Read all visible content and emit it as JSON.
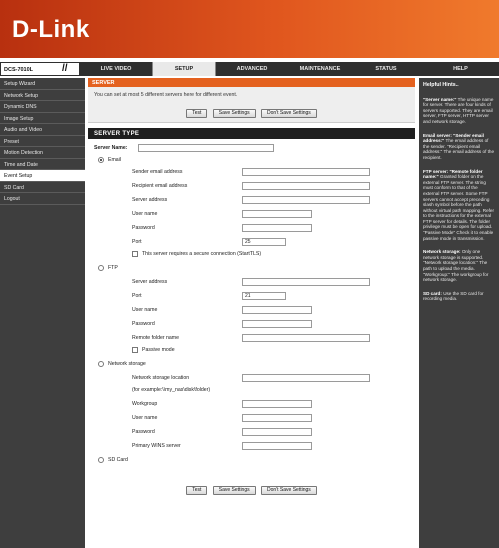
{
  "brand": {
    "logo": "D-Link"
  },
  "nav": {
    "model": "DCS-7010L",
    "tabs": [
      "LIVE VIDEO",
      "SETUP",
      "ADVANCED",
      "MAINTENANCE",
      "STATUS",
      "HELP"
    ],
    "active_tab": "SETUP"
  },
  "sidebar": {
    "items": [
      "Setup Wizard",
      "Network Setup",
      "Dynamic DNS",
      "Image Setup",
      "Audio and Video",
      "Preset",
      "Motion Detection",
      "Time and Date",
      "Event Setup",
      "SD Card",
      "Logout"
    ],
    "active": "Event Setup"
  },
  "server": {
    "header": "SERVER",
    "info": "You can set at most 5 different servers here for different event.",
    "buttons": {
      "test": "Test",
      "save": "Save Settings",
      "dont_save": "Don't Save Settings"
    }
  },
  "server_type": {
    "header": "SERVER TYPE",
    "server_name_label": "Server Name:",
    "server_name_value": "",
    "email": {
      "label": "Email",
      "selected": true,
      "sender_label": "Sender email address",
      "recipient_label": "Recipient email address",
      "server_label": "Server address",
      "user_label": "User name",
      "password_label": "Password",
      "port_label": "Port",
      "port_value": "25",
      "secure_label": "This server requires a secure connection (StartTLS)"
    },
    "ftp": {
      "label": "FTP",
      "server_label": "Server address",
      "port_label": "Port",
      "port_value": "21",
      "user_label": "User name",
      "password_label": "Password",
      "folder_label": "Remote folder name",
      "passive_label": "Passive mode"
    },
    "network": {
      "label": "Network storage",
      "location_label": "Network storage location",
      "example": "(for example:\\\\my_nas\\disk\\folder)",
      "workgroup_label": "Workgroup",
      "user_label": "User name",
      "password_label": "Password",
      "wins_label": "Primary WINS server"
    },
    "sdcard": {
      "label": "SD Card"
    }
  },
  "help": {
    "title": "Helpful Hints..",
    "blocks": [
      {
        "title": "\"Server name:\"",
        "text": "The unique name for server. There are four kinds of servers supported. They are email server, FTP server, HTTP server and network storage."
      },
      {
        "title": "Email server: \"Sender email address:\"",
        "text": "The email address of the sender. \"Recipient email address:\" The email address of the recipient."
      },
      {
        "title": "FTP server: \"Remote folder name:\"",
        "text": "Granted folder on the external FTP server. The string must conform to that of the external FTP server. Some FTP servers cannot accept preceding slash symbol before the path without virtual path mapping. Refer to the instructions for the external FTP server for details. The folder privilege must be open for upload. \"Passive Mode\" Check it to enable passive mode in transmission."
      },
      {
        "title": "Network storage:",
        "text": "Only one network storage is supported. \"Network storage location:\" The path to upload the media. \"Workgroup:\" The workgroup for network storage."
      },
      {
        "title": "SD card:",
        "text": "Use the SD card for recording media."
      }
    ]
  }
}
